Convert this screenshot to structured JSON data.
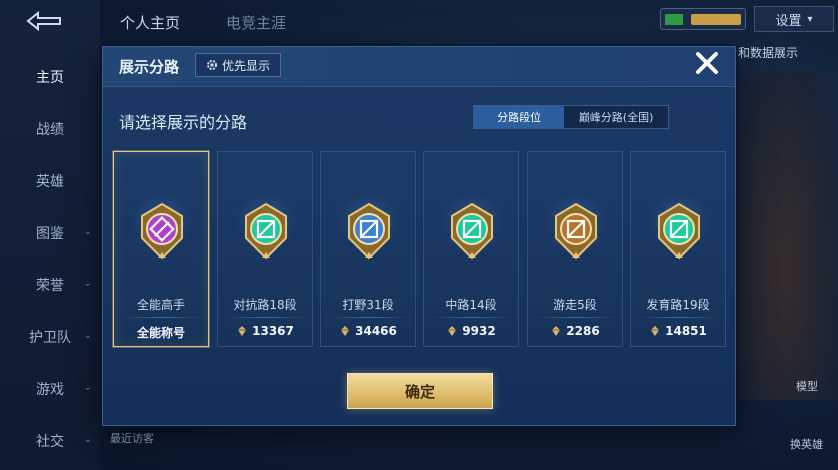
{
  "background": {
    "top_tabs": [
      "个人主页",
      "电竞主涯"
    ],
    "sidebar": [
      "主页",
      "战绩",
      "英雄",
      "图鉴",
      "荣誉",
      "护卫队",
      "游戏",
      "社交"
    ],
    "settings_label": "设置",
    "right_text": "和数据展示",
    "right_labels": [
      "模型",
      "换英雄"
    ],
    "bottom_text": "最近访客"
  },
  "modal": {
    "title": "展示分路",
    "priority_label": "优先显示",
    "subtitle": "请选择展示的分路",
    "segments": [
      {
        "label": "分路段位",
        "active": true
      },
      {
        "label": "巅峰分路(全国)",
        "active": false
      }
    ],
    "cards": [
      {
        "rank": "全能高手",
        "stat": "全能称号",
        "show_diamond": false,
        "selected": true,
        "emblem": "purple-emblem-icon",
        "color": "#b03fd0"
      },
      {
        "rank": "对抗路18段",
        "stat": "13367",
        "show_diamond": true,
        "selected": false,
        "emblem": "teal-emblem-icon",
        "color": "#1fc9a0"
      },
      {
        "rank": "打野31段",
        "stat": "34466",
        "show_diamond": true,
        "selected": false,
        "emblem": "dragon-emblem-icon",
        "color": "#3c7fd8"
      },
      {
        "rank": "中路14段",
        "stat": "9932",
        "show_diamond": true,
        "selected": false,
        "emblem": "teal-emblem-icon",
        "color": "#1fc9a0"
      },
      {
        "rank": "游走5段",
        "stat": "2286",
        "show_diamond": true,
        "selected": false,
        "emblem": "bronze-emblem-icon",
        "color": "#b8742d"
      },
      {
        "rank": "发育路19段",
        "stat": "14851",
        "show_diamond": true,
        "selected": false,
        "emblem": "teal-emblem-icon",
        "color": "#1fc9a0"
      }
    ],
    "confirm_label": "确定"
  }
}
